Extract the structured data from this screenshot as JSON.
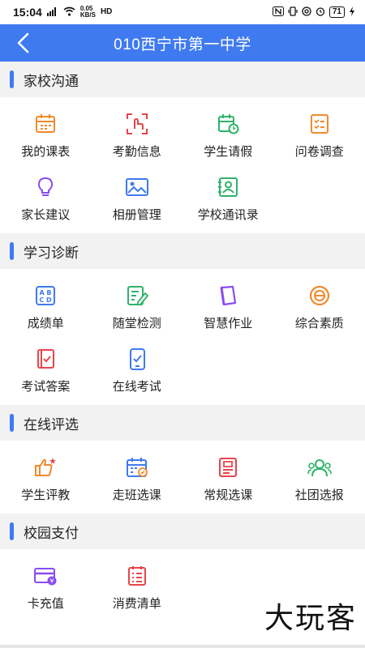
{
  "status": {
    "time": "15:04",
    "speed_top": "0.05",
    "speed_bottom": "KB/S",
    "hd": "HD",
    "battery": "71"
  },
  "nav": {
    "title": "010西宁市第一中学"
  },
  "sections": [
    {
      "title": "家校沟通",
      "items": [
        {
          "label": "我的课表",
          "icon": "calendar-icon"
        },
        {
          "label": "考勤信息",
          "icon": "attendance-scan-icon"
        },
        {
          "label": "学生请假",
          "icon": "leave-calendar-icon"
        },
        {
          "label": "问卷调查",
          "icon": "survey-icon"
        },
        {
          "label": "家长建议",
          "icon": "lightbulb-icon"
        },
        {
          "label": "相册管理",
          "icon": "photo-album-icon"
        },
        {
          "label": "学校通讯录",
          "icon": "contacts-icon"
        }
      ]
    },
    {
      "title": "学习诊断",
      "items": [
        {
          "label": "成绩单",
          "icon": "abcd-icon"
        },
        {
          "label": "随堂检测",
          "icon": "edit-note-icon"
        },
        {
          "label": "智慧作业",
          "icon": "homework-icon"
        },
        {
          "label": "综合素质",
          "icon": "quality-badge-icon"
        },
        {
          "label": "考试答案",
          "icon": "exam-answer-icon"
        },
        {
          "label": "在线考试",
          "icon": "online-exam-icon"
        }
      ]
    },
    {
      "title": "在线评选",
      "items": [
        {
          "label": "学生评教",
          "icon": "thumbs-up-icon"
        },
        {
          "label": "走班选课",
          "icon": "class-select-icon"
        },
        {
          "label": "常规选课",
          "icon": "course-select-icon"
        },
        {
          "label": "社团选报",
          "icon": "club-icon"
        }
      ]
    },
    {
      "title": "校园支付",
      "items": [
        {
          "label": "卡充值",
          "icon": "card-recharge-icon"
        },
        {
          "label": "消费清单",
          "icon": "bill-list-icon"
        }
      ]
    }
  ],
  "watermark": "大玩客",
  "colors": {
    "accent": "#3f7af0",
    "orange": "#f08a2c",
    "red": "#e8454c",
    "green": "#2fb36a",
    "purple": "#8a4cf0",
    "blue": "#3f7af0"
  }
}
